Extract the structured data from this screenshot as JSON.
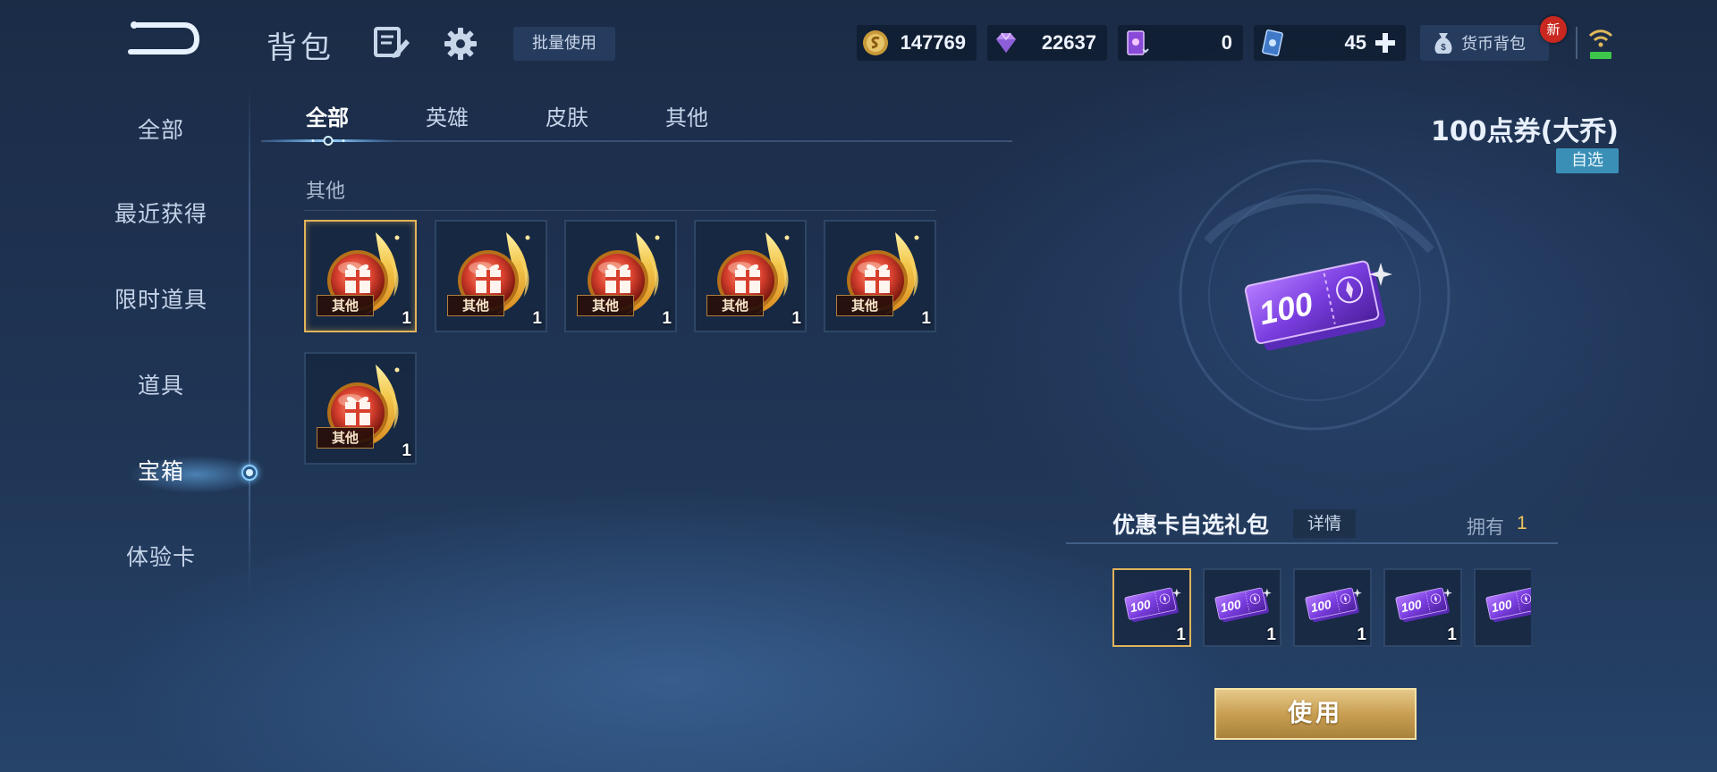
{
  "header": {
    "title": "背包",
    "batch_use_label": "批量使用",
    "currencies": {
      "gold": "147769",
      "gems": "22637",
      "cards": "0",
      "tickets": "45"
    },
    "wallet_label": "货币背包",
    "new_badge": "新"
  },
  "sidebar": {
    "items": [
      {
        "label": "全部"
      },
      {
        "label": "最近获得"
      },
      {
        "label": "限时道具"
      },
      {
        "label": "道具"
      },
      {
        "label": "宝箱"
      },
      {
        "label": "体验卡"
      }
    ],
    "active_index": 4
  },
  "tabs": {
    "items": [
      {
        "label": "全部"
      },
      {
        "label": "英雄"
      },
      {
        "label": "皮肤"
      },
      {
        "label": "其他"
      }
    ],
    "active_index": 0
  },
  "grid": {
    "section_label": "其他",
    "items": [
      {
        "tag": "其他",
        "qty": "1",
        "selected": true
      },
      {
        "tag": "其他",
        "qty": "1"
      },
      {
        "tag": "其他",
        "qty": "1"
      },
      {
        "tag": "其他",
        "qty": "1"
      },
      {
        "tag": "其他",
        "qty": "1"
      },
      {
        "tag": "其他",
        "qty": "1"
      }
    ]
  },
  "detail": {
    "title": "100点券(大乔)",
    "badge": "自选",
    "ticket_value": "100",
    "pack_name": "优惠卡自选礼包",
    "detail_label": "详情",
    "own_label": "拥有",
    "own_count": "1",
    "options": [
      {
        "value": "100",
        "qty": "1",
        "selected": true
      },
      {
        "value": "100",
        "qty": "1"
      },
      {
        "value": "100",
        "qty": "1"
      },
      {
        "value": "100",
        "qty": "1"
      },
      {
        "value": "100",
        "qty": ""
      }
    ],
    "use_label": "使用"
  },
  "colors": {
    "accent_gold": "#e0b45a",
    "badge_blue": "#3a8fb6",
    "new_red": "#c8281f"
  }
}
